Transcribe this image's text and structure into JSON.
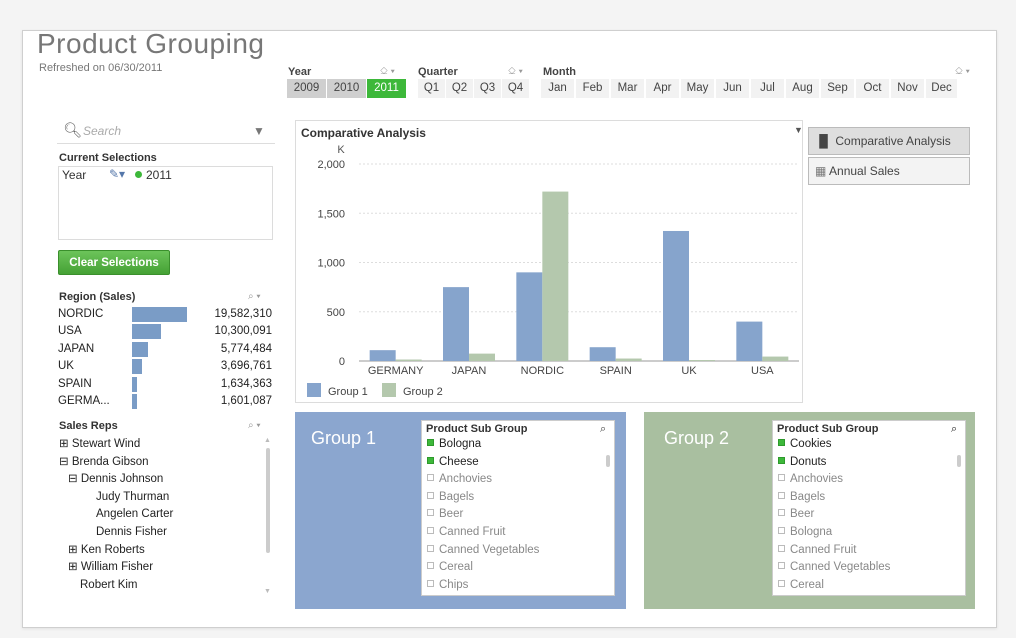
{
  "header": {
    "title": "Product Grouping",
    "refreshed": "Refreshed on 06/30/2011"
  },
  "filters": {
    "year": {
      "label": "Year",
      "values": [
        "2009",
        "2010",
        "2011"
      ],
      "selected": "2011"
    },
    "quarter": {
      "label": "Quarter",
      "values": [
        "Q1",
        "Q2",
        "Q3",
        "Q4"
      ]
    },
    "month": {
      "label": "Month",
      "values": [
        "Jan",
        "Feb",
        "Mar",
        "Apr",
        "May",
        "Jun",
        "Jul",
        "Aug",
        "Sep",
        "Oct",
        "Nov",
        "Dec"
      ]
    },
    "icons": "⎐ ▾"
  },
  "search": {
    "placeholder": "Search"
  },
  "current_selections": {
    "title": "Current Selections",
    "field": "Year",
    "value": "2011"
  },
  "clear_button": "Clear Selections",
  "region": {
    "title": "Region (Sales)",
    "rows": [
      {
        "name": "NORDIC",
        "value": "19,582,310",
        "share": 1.0
      },
      {
        "name": "USA",
        "value": "10,300,091",
        "share": 0.526
      },
      {
        "name": "JAPAN",
        "value": "5,774,484",
        "share": 0.295
      },
      {
        "name": "UK",
        "value": "3,696,761",
        "share": 0.189
      },
      {
        "name": "SPAIN",
        "value": "1,634,363",
        "share": 0.083
      },
      {
        "name": "GERMA...",
        "value": "1,601,087",
        "share": 0.082
      }
    ]
  },
  "sales_reps": {
    "title": "Sales Reps",
    "rows": [
      {
        "label": "⊞ Stewart Wind",
        "level": 0
      },
      {
        "label": "⊟ Brenda Gibson",
        "level": 0
      },
      {
        "label": "⊟ Dennis Johnson",
        "level": 1
      },
      {
        "label": "Judy Thurman",
        "level": 2
      },
      {
        "label": "Angelen Carter",
        "level": 2
      },
      {
        "label": "Dennis Fisher",
        "level": 2
      },
      {
        "label": "⊞ Ken Roberts",
        "level": 1
      },
      {
        "label": "⊞ William Fisher",
        "level": 1
      },
      {
        "label": "Robert Kim",
        "level": 1
      }
    ]
  },
  "chart_tabs": [
    "Comparative Analysis",
    "Annual Sales"
  ],
  "chart_data": {
    "type": "bar",
    "title": "Comparative Analysis",
    "ylabel": "K",
    "categories": [
      "GERMANY",
      "JAPAN",
      "NORDIC",
      "SPAIN",
      "UK",
      "USA"
    ],
    "series": [
      {
        "name": "Group 1",
        "color": "#86a4cc",
        "values": [
          110,
          750,
          900,
          140,
          1320,
          400
        ]
      },
      {
        "name": "Group 2",
        "color": "#b4c8ad",
        "values": [
          15,
          75,
          1720,
          25,
          10,
          45
        ]
      }
    ],
    "ylim": [
      0,
      2000
    ],
    "yticks": [
      "0",
      "500",
      "1,000",
      "1,500",
      "2,000"
    ],
    "grid": true,
    "legend": "bottom-left"
  },
  "groups": [
    {
      "title": "Group 1",
      "color": "#8ba6cf",
      "list_title": "Product Sub Group",
      "items": [
        {
          "label": "Bologna",
          "selected": true
        },
        {
          "label": "Cheese",
          "selected": true
        },
        {
          "label": "Anchovies",
          "selected": false
        },
        {
          "label": "Bagels",
          "selected": false
        },
        {
          "label": "Beer",
          "selected": false
        },
        {
          "label": "Canned Fruit",
          "selected": false
        },
        {
          "label": "Canned Vegetables",
          "selected": false
        },
        {
          "label": "Cereal",
          "selected": false
        },
        {
          "label": "Chips",
          "selected": false
        }
      ]
    },
    {
      "title": "Group 2",
      "color": "#a9bfa0",
      "list_title": "Product Sub Group",
      "items": [
        {
          "label": "Cookies",
          "selected": true
        },
        {
          "label": "Donuts",
          "selected": true
        },
        {
          "label": "Anchovies",
          "selected": false
        },
        {
          "label": "Bagels",
          "selected": false
        },
        {
          "label": "Beer",
          "selected": false
        },
        {
          "label": "Bologna",
          "selected": false
        },
        {
          "label": "Canned Fruit",
          "selected": false
        },
        {
          "label": "Canned Vegetables",
          "selected": false
        },
        {
          "label": "Cereal",
          "selected": false
        }
      ]
    }
  ]
}
